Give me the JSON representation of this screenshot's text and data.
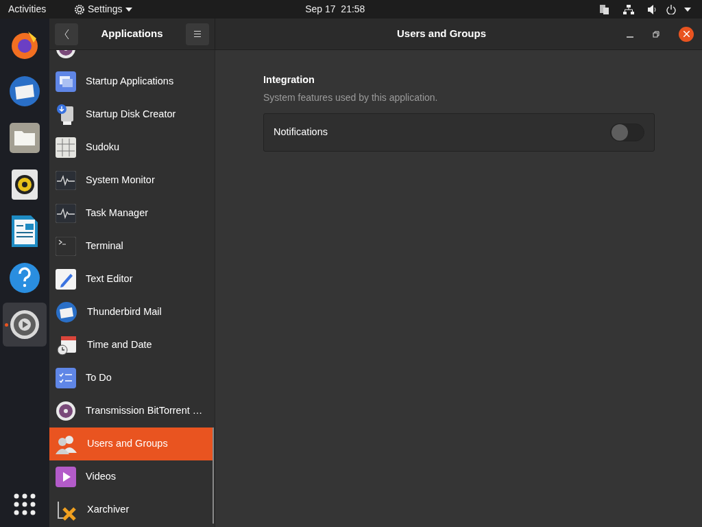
{
  "top_bar": {
    "activities": "Activities",
    "app_menu": "Settings",
    "clock": "Sep 17  21:58"
  },
  "dock": {
    "items": [
      {
        "kind": "firefox",
        "running": false
      },
      {
        "kind": "mail",
        "running": false
      },
      {
        "kind": "files",
        "running": false
      },
      {
        "kind": "music",
        "running": false
      },
      {
        "kind": "document",
        "running": false
      },
      {
        "kind": "help",
        "running": false
      },
      {
        "kind": "settings",
        "running": true
      }
    ]
  },
  "sidebar": {
    "title": "Applications",
    "items": [
      {
        "kind": "disc",
        "selected": false
      },
      {
        "label": "Startup Applications",
        "kind": "windows",
        "selected": false
      },
      {
        "label": "Startup Disk Creator",
        "kind": "usb",
        "selected": false
      },
      {
        "label": "Sudoku",
        "kind": "grid",
        "selected": false
      },
      {
        "label": "System Monitor",
        "kind": "pulse",
        "selected": false
      },
      {
        "label": "Task Manager",
        "kind": "pulse",
        "selected": false
      },
      {
        "label": "Terminal",
        "kind": "terminal",
        "selected": false
      },
      {
        "label": "Text Editor",
        "kind": "pen",
        "selected": false
      },
      {
        "label": "Thunderbird Mail",
        "kind": "mail",
        "selected": false
      },
      {
        "label": "Time and Date",
        "kind": "calendar",
        "selected": false
      },
      {
        "label": "To Do",
        "kind": "checklist",
        "selected": false
      },
      {
        "label": "Transmission BitTorrent …",
        "kind": "disc",
        "selected": false
      },
      {
        "label": "Users and Groups",
        "kind": "users",
        "selected": true
      },
      {
        "label": "Videos",
        "kind": "play",
        "selected": false
      },
      {
        "label": "Xarchiver",
        "kind": "archive",
        "selected": false
      }
    ]
  },
  "main": {
    "title": "Users and Groups",
    "section": {
      "heading": "Integration",
      "description": "System features used by this application.",
      "rows": [
        {
          "label": "Notifications",
          "on": false
        }
      ]
    }
  }
}
